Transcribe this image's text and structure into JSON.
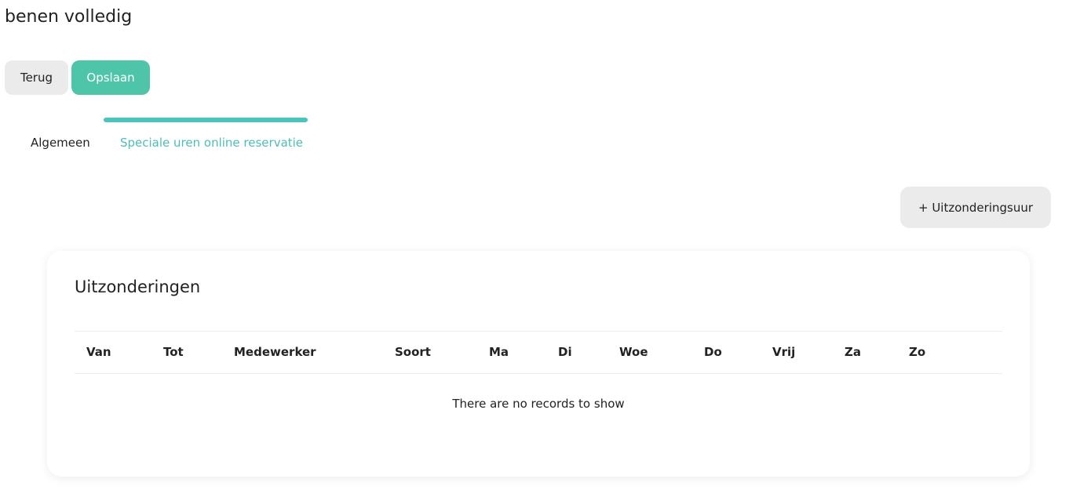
{
  "header": {
    "title": "benen volledig"
  },
  "toolbar": {
    "back_label": "Terug",
    "save_label": "Opslaan"
  },
  "tabs": [
    {
      "label": "Algemeen",
      "active": false
    },
    {
      "label": "Speciale uren online reservatie",
      "active": true
    }
  ],
  "actions": {
    "add_exception_label": "+ Uitzonderingsuur"
  },
  "exceptions": {
    "title": "Uitzonderingen",
    "columns": [
      "Van",
      "Tot",
      "Medewerker",
      "Soort",
      "Ma",
      "Di",
      "Woe",
      "Do",
      "Vrij",
      "Za",
      "Zo"
    ],
    "rows": [],
    "empty_message": "There are no records to show"
  },
  "colors": {
    "accent": "#4ec5a8",
    "tab_active": "#4dbdb7",
    "button_neutral": "#ebebeb"
  }
}
